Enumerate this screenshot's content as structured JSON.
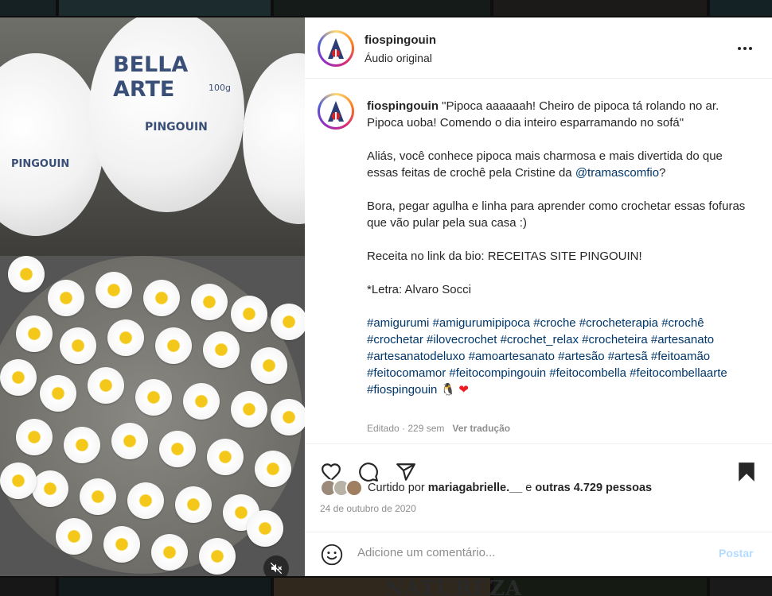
{
  "background": {
    "text": "NATUREZA"
  },
  "media": {
    "ball_brand": "BELLA ARTE",
    "ball_weight": "100g",
    "ball_logo": "PINGOUIN",
    "ball_logo_small": "PINGOUIN",
    "mute_icon": "speaker-muted-icon"
  },
  "header": {
    "username": "fiospingouin",
    "subtitle": "Áudio original",
    "more_icon": "more-options-icon"
  },
  "caption": {
    "username": "fiospingouin",
    "p1": "\"Pipoca aaaaaah! Cheiro de pipoca tá rolando no ar. Pipoca uoba! Comendo o dia inteiro esparramando no sofá\"",
    "p2_before": "Aliás, você conhece pipoca mais charmosa e mais divertida do que essas feitas de crochê pela Cristine da ",
    "p2_mention": "@tramascomfio",
    "p2_after": "?",
    "p3": "Bora, pegar agulha e linha para aprender como crochetar essas fofuras que vão pular pela sua casa :)",
    "p4": "Receita no link da bio: RECEITAS SITE PINGOUIN!",
    "p5": "*Letra: Alvaro Socci",
    "hashtags": "#amigurumi #amigurumipipoca #croche #crocheterapia #crochê #crochetar #ilovecrochet #crochet_relax #crocheteira #artesanato #artesanatodeluxo #amoartesanato #artesão #artesã #feitoamão #feitocomamor #feitocompingouin #feitocombella #feitocombellaarte #fiospingouin",
    "emoji": "🐧 ❤",
    "edited": "Editado · 229 sem",
    "see_translation": "Ver tradução"
  },
  "actions": {
    "like_icon": "heart-icon",
    "comment_icon": "comment-icon",
    "share_icon": "share-icon",
    "save_icon": "bookmark-icon",
    "likes_prefix": "Curtido por ",
    "likes_user": "mariagabrielle.__",
    "likes_middle": " e ",
    "likes_count": "outras 4.729 pessoas",
    "date": "24 de outubro de 2020"
  },
  "comment": {
    "placeholder": "Adicione um comentário...",
    "post_label": "Postar",
    "emoji_icon": "smiley-icon"
  },
  "colors": {
    "link": "#00376b",
    "post_disabled": "#b3dbff",
    "heart": "#ed1c24"
  }
}
